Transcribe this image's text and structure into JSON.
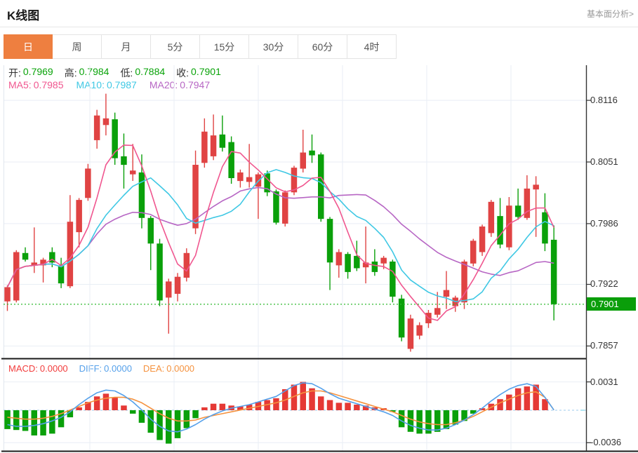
{
  "header": {
    "title": "K线图",
    "link_label": "基本面分析>"
  },
  "tabs": {
    "active_index": 0,
    "items": [
      {
        "id": "day",
        "label": "日"
      },
      {
        "id": "week",
        "label": "周"
      },
      {
        "id": "month",
        "label": "月"
      },
      {
        "id": "5min",
        "label": "5分"
      },
      {
        "id": "15min",
        "label": "15分"
      },
      {
        "id": "30min",
        "label": "30分"
      },
      {
        "id": "60min",
        "label": "60分"
      },
      {
        "id": "4hour",
        "label": "4时"
      }
    ]
  },
  "indicators": {
    "ohlc_value_color": "#09a309",
    "ohlc": [
      {
        "id": "open",
        "label": "开:",
        "value": "0.7969"
      },
      {
        "id": "high",
        "label": "高:",
        "value": "0.7984"
      },
      {
        "id": "low",
        "label": "低:",
        "value": "0.7884"
      },
      {
        "id": "close",
        "label": "收:",
        "value": "0.7901"
      }
    ],
    "ma": [
      {
        "id": "ma5",
        "label": "MA5:",
        "value": "0.7985",
        "color": "#f0568f"
      },
      {
        "id": "ma10",
        "label": "MA10:",
        "value": "0.7987",
        "color": "#3fc8e4"
      },
      {
        "id": "ma20",
        "label": "MA20:",
        "value": "0.7947",
        "color": "#b766c4"
      }
    ],
    "macd": [
      {
        "id": "macd",
        "label": "MACD:",
        "value": "0.0000",
        "color": "#f23c3c"
      },
      {
        "id": "diff",
        "label": "DIFF:",
        "value": "0.0000",
        "color": "#55a0ea"
      },
      {
        "id": "dea",
        "label": "DEA:",
        "value": "0.0000",
        "color": "#f5923e"
      }
    ]
  },
  "price_axis": {
    "tick_labels": [
      "0.8116",
      "0.8051",
      "0.7986",
      "0.7922",
      "0.7857"
    ],
    "current_label": "0.7901"
  },
  "macd_axis": {
    "tick_labels": [
      "0.0031",
      "-0.0036"
    ]
  },
  "chart_data": {
    "type": "candlestick",
    "panels": [
      "price",
      "macd"
    ],
    "interval": "日",
    "price_ylim": [
      0.7844,
      0.8153
    ],
    "price_gridlines": [
      0.8116,
      0.8051,
      0.7986,
      0.7922,
      0.7857
    ],
    "current_price": 0.7901,
    "ma_periods": [
      5,
      10,
      20
    ],
    "candles_ohlc": [
      [
        0.7904,
        0.7921,
        0.7894,
        0.7919
      ],
      [
        0.7905,
        0.7958,
        0.7903,
        0.7956
      ],
      [
        0.7955,
        0.7961,
        0.7946,
        0.7948
      ],
      [
        0.7942,
        0.7982,
        0.7934,
        0.7945
      ],
      [
        0.7942,
        0.795,
        0.7924,
        0.7948
      ],
      [
        0.7956,
        0.7961,
        0.794,
        0.7945
      ],
      [
        0.7942,
        0.795,
        0.7918,
        0.7923
      ],
      [
        0.792,
        0.8016,
        0.7918,
        0.7988
      ],
      [
        0.7977,
        0.8013,
        0.7961,
        0.8011
      ],
      [
        0.8013,
        0.8049,
        0.801,
        0.8044
      ],
      [
        0.8074,
        0.8106,
        0.8065,
        0.81
      ],
      [
        0.809,
        0.8123,
        0.8079,
        0.8097
      ],
      [
        0.8096,
        0.8103,
        0.8048,
        0.8055
      ],
      [
        0.8057,
        0.8081,
        0.8023,
        0.8048
      ],
      [
        0.8038,
        0.807,
        0.8031,
        0.8042
      ],
      [
        0.804,
        0.8059,
        0.7981,
        0.7992
      ],
      [
        0.7992,
        0.7994,
        0.7937,
        0.7965
      ],
      [
        0.7965,
        0.797,
        0.7899,
        0.7905
      ],
      [
        0.7908,
        0.7928,
        0.787,
        0.7925
      ],
      [
        0.7912,
        0.7934,
        0.7904,
        0.793
      ],
      [
        0.7929,
        0.796,
        0.7925,
        0.7955
      ],
      [
        0.7981,
        0.8063,
        0.7975,
        0.8048
      ],
      [
        0.805,
        0.8097,
        0.8045,
        0.8083
      ],
      [
        0.8057,
        0.8101,
        0.8053,
        0.8079
      ],
      [
        0.808,
        0.81,
        0.8062,
        0.8066
      ],
      [
        0.8072,
        0.8078,
        0.8028,
        0.8034
      ],
      [
        0.8031,
        0.8043,
        0.8024,
        0.804
      ],
      [
        0.803,
        0.807,
        0.8024,
        0.8035
      ],
      [
        0.8025,
        0.804,
        0.7991,
        0.8038
      ],
      [
        0.8039,
        0.8042,
        0.8015,
        0.8019
      ],
      [
        0.802,
        0.8022,
        0.7985,
        0.7987
      ],
      [
        0.7986,
        0.8021,
        0.7983,
        0.8019
      ],
      [
        0.8019,
        0.8047,
        0.8016,
        0.8045
      ],
      [
        0.8044,
        0.8085,
        0.804,
        0.8061
      ],
      [
        0.8063,
        0.808,
        0.805,
        0.8058
      ],
      [
        0.8059,
        0.8061,
        0.7988,
        0.7991
      ],
      [
        0.7991,
        0.7993,
        0.7916,
        0.7945
      ],
      [
        0.7942,
        0.7959,
        0.7929,
        0.7956
      ],
      [
        0.7954,
        0.7956,
        0.7928,
        0.7935
      ],
      [
        0.7952,
        0.7968,
        0.7936,
        0.7939
      ],
      [
        0.794,
        0.7983,
        0.7923,
        0.7945
      ],
      [
        0.7946,
        0.7959,
        0.7931,
        0.7935
      ],
      [
        0.7944,
        0.7952,
        0.7938,
        0.795
      ],
      [
        0.7946,
        0.7948,
        0.7903,
        0.7909
      ],
      [
        0.7907,
        0.7911,
        0.7862,
        0.7866
      ],
      [
        0.7854,
        0.789,
        0.7851,
        0.7886
      ],
      [
        0.7868,
        0.7882,
        0.7864,
        0.7879
      ],
      [
        0.7881,
        0.7895,
        0.7876,
        0.7892
      ],
      [
        0.789,
        0.7914,
        0.7887,
        0.7897
      ],
      [
        0.7909,
        0.7936,
        0.7896,
        0.7916
      ],
      [
        0.7899,
        0.791,
        0.7893,
        0.7908
      ],
      [
        0.7903,
        0.7948,
        0.7896,
        0.7946
      ],
      [
        0.7944,
        0.797,
        0.7941,
        0.7968
      ],
      [
        0.7956,
        0.7985,
        0.7952,
        0.7983
      ],
      [
        0.7976,
        0.8011,
        0.7972,
        0.8009
      ],
      [
        0.7994,
        0.8013,
        0.796,
        0.7964
      ],
      [
        0.7961,
        0.8014,
        0.7958,
        0.8005
      ],
      [
        0.8005,
        0.8023,
        0.799,
        0.7993
      ],
      [
        0.7992,
        0.8037,
        0.799,
        0.8023
      ],
      [
        0.8022,
        0.8036,
        0.7972,
        0.8027
      ],
      [
        0.7998,
        0.8018,
        0.7957,
        0.7965
      ],
      [
        0.7969,
        0.7984,
        0.7884,
        0.7901
      ]
    ],
    "macd": {
      "ylim": [
        -0.0045,
        0.005
      ],
      "gridlines": [
        0.0031,
        -0.0036
      ],
      "hist": [
        -0.0021,
        -0.0022,
        -0.0023,
        -0.0028,
        -0.0028,
        -0.0026,
        -0.0019,
        -0.0008,
        0.0003,
        0.0009,
        0.0015,
        0.0018,
        0.0014,
        0.0005,
        -0.0004,
        -0.0014,
        -0.0025,
        -0.0033,
        -0.0037,
        -0.0031,
        -0.002,
        -0.0009,
        0.0003,
        0.0007,
        0.0007,
        0.0005,
        0.0004,
        0.0006,
        0.0009,
        0.0011,
        0.0013,
        0.0023,
        0.0028,
        0.0031,
        0.0024,
        0.0015,
        0.0011,
        0.0008,
        0.0008,
        0.0006,
        0.0005,
        0.0003,
        0.0002,
        -0.0002,
        -0.0019,
        -0.0024,
        -0.0026,
        -0.0026,
        -0.0024,
        -0.0021,
        -0.0016,
        -0.0012,
        -0.0004,
        0.0002,
        0.0007,
        0.0012,
        0.0017,
        0.0024,
        0.0026,
        0.0028,
        0.0012,
        0.0
      ],
      "diff": [
        -0.0016,
        -0.0018,
        -0.0018,
        -0.0017,
        -0.0015,
        -0.0012,
        -0.0008,
        -0.0002,
        0.0006,
        0.0013,
        0.0019,
        0.0022,
        0.0021,
        0.0016,
        0.0009,
        0.0,
        -0.001,
        -0.0018,
        -0.0023,
        -0.0024,
        -0.0021,
        -0.0016,
        -0.001,
        -0.0005,
        -0.0001,
        0.0002,
        0.0004,
        0.0006,
        0.0009,
        0.0012,
        0.0015,
        0.0021,
        0.0027,
        0.003,
        0.0029,
        0.0024,
        0.0018,
        0.0013,
        0.001,
        0.0007,
        0.0004,
        0.0001,
        -0.0002,
        -0.0006,
        -0.0012,
        -0.0017,
        -0.002,
        -0.0022,
        -0.0022,
        -0.002,
        -0.0016,
        -0.0011,
        -0.0005,
        0.0002,
        0.001,
        0.0017,
        0.0023,
        0.0027,
        0.0029,
        0.0026,
        0.0014,
        0.0
      ],
      "dea": [
        -0.0008,
        -0.0009,
        -0.001,
        -0.001,
        -0.0009,
        -0.0007,
        -0.0004,
        0.0,
        0.0004,
        0.0008,
        0.0011,
        0.0013,
        0.0014,
        0.0014,
        0.0012,
        0.0008,
        0.0002,
        -0.0004,
        -0.0009,
        -0.0012,
        -0.0012,
        -0.0011,
        -0.0008,
        -0.0006,
        -0.0004,
        -0.0002,
        0.0,
        0.0002,
        0.0004,
        0.0006,
        0.0008,
        0.0011,
        0.0015,
        0.0019,
        0.0021,
        0.0021,
        0.0019,
        0.0016,
        0.0013,
        0.001,
        0.0007,
        0.0004,
        0.0001,
        -0.0002,
        -0.0006,
        -0.001,
        -0.0013,
        -0.0015,
        -0.0016,
        -0.0016,
        -0.0014,
        -0.0011,
        -0.0007,
        -0.0002,
        0.0003,
        0.0008,
        0.0012,
        0.0016,
        0.0019,
        0.002,
        0.0014,
        0.0
      ]
    },
    "colors": {
      "up": "#e04343",
      "down": "#0aa00a",
      "ma5": "#f0568f",
      "ma10": "#3fc8e4",
      "ma20": "#b766c4",
      "diff_line": "#55a0ea",
      "dea_line": "#f5923e",
      "hist_up": "#e53935",
      "hist_down": "#0aa00a",
      "current_line": "#2db82d",
      "current_label_bg": "#0a9e0a",
      "tab_active_bg": "#ee7f40",
      "gridline": "#e9eef5",
      "axis_dark": "#1a1a1a"
    }
  }
}
